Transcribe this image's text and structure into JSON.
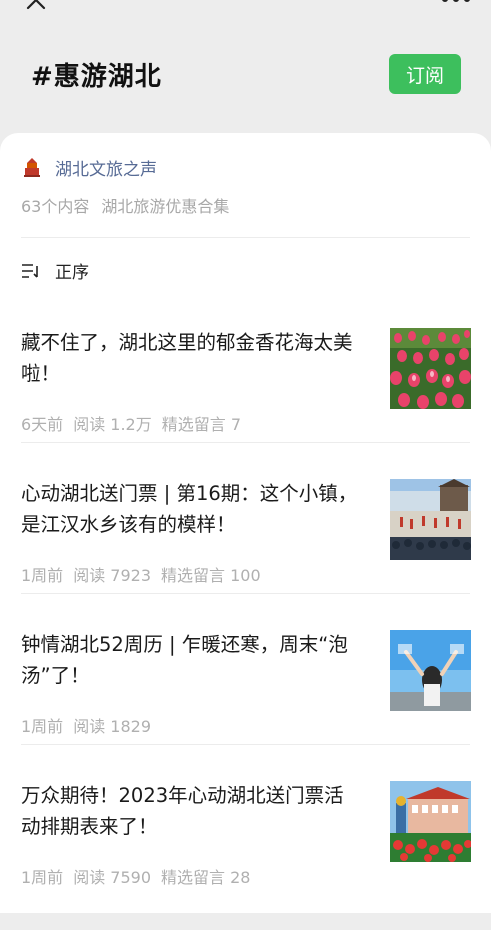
{
  "header": {
    "topic_title": "#惠游湖北",
    "subscribe_label": "订阅"
  },
  "account": {
    "name": "湖北文旅之声",
    "count_label": "63个内容",
    "collection_name": "湖北旅游优惠合集"
  },
  "sort": {
    "label": "正序"
  },
  "articles": [
    {
      "title": "藏不住了，湖北这里的郁金香花海太美啦！",
      "time": "6天前",
      "reads": "阅读 1.2万",
      "comments": "精选留言 7"
    },
    {
      "title": "心动湖北送门票 | 第16期：这个小镇，是江汉水乡该有的模样！",
      "time": "1周前",
      "reads": "阅读 7923",
      "comments": "精选留言 100"
    },
    {
      "title": "钟情湖北52周历 | 乍暖还寒，周末“泡汤”了！",
      "time": "1周前",
      "reads": "阅读 1829",
      "comments": ""
    },
    {
      "title": "万众期待！2023年心动湖北送门票活动排期表来了！",
      "time": "1周前",
      "reads": "阅读 7590",
      "comments": "精选留言 28"
    }
  ],
  "colors": {
    "subscribe": "#3dbf5d",
    "account_link": "#576b95"
  },
  "icons": [
    "close-icon",
    "more-icon",
    "account-logo",
    "sort-icon"
  ]
}
